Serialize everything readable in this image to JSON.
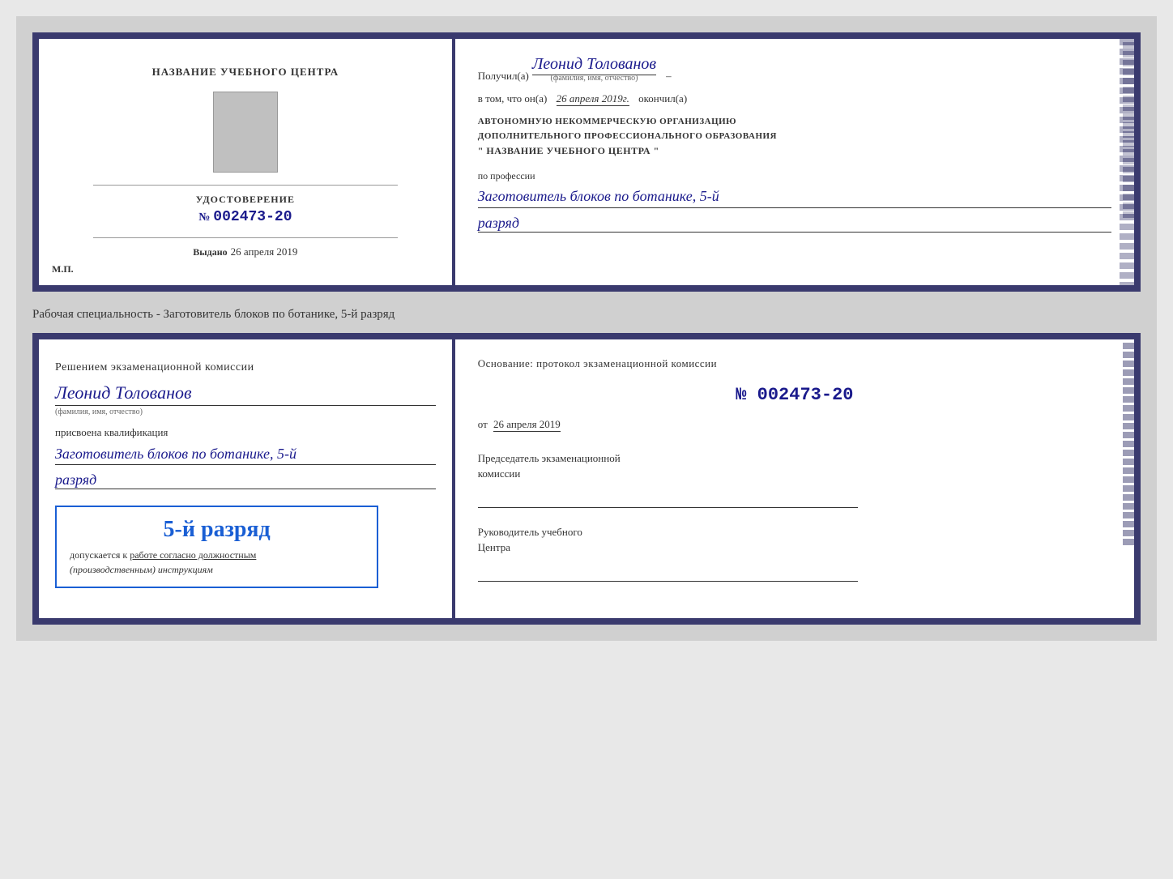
{
  "page": {
    "background": "#d0d0d0"
  },
  "cert1": {
    "left": {
      "title": "НАЗВАНИЕ УЧЕБНОГО ЦЕНТРА",
      "doc_label": "УДОСТОВЕРЕНИЕ",
      "doc_number_prefix": "№",
      "doc_number": "002473-20",
      "issued_label": "Выдано",
      "issued_date": "26 апреля 2019",
      "mp_label": "М.П."
    },
    "right": {
      "received_prefix": "Получил(а)",
      "recipient_name": "Леонид Толованов",
      "fio_label": "(фамилия, имя, отчество)",
      "date_prefix": "в том, что он(а)",
      "date_value": "26 апреля 2019г.",
      "date_suffix": "окончил(а)",
      "org_line1": "АВТОНОМНУЮ НЕКОММЕРЧЕСКУЮ ОРГАНИЗАЦИЮ",
      "org_line2": "ДОПОЛНИТЕЛЬНОГО ПРОФЕССИОНАЛЬНОГО ОБРАЗОВАНИЯ",
      "org_quotes": "\"",
      "org_name": "НАЗВАНИЕ УЧЕБНОГО ЦЕНТРА",
      "profession_label": "по профессии",
      "profession_value": "Заготовитель блоков по ботанике, 5-й",
      "rank_value": "разряд"
    }
  },
  "specialty_text": "Рабочая специальность - Заготовитель блоков по ботанике, 5-й разряд",
  "cert2": {
    "left": {
      "decision_text": "Решением экзаменационной комиссии",
      "person_name": "Леонид Толованов",
      "fio_label": "(фамилия, имя, отчество)",
      "assigned_label": "присвоена квалификация",
      "qualification": "Заготовитель блоков по ботанике, 5-й",
      "rank": "разряд",
      "stamp_rank": "5-й разряд",
      "stamp_prefix": "допускается к",
      "stamp_link_text": "работе согласно должностным",
      "stamp_suffix": "(производственным) инструкциям"
    },
    "right": {
      "basis_label": "Основание: протокол экзаменационной комиссии",
      "number_prefix": "№",
      "protocol_number": "002473-20",
      "date_prefix": "от",
      "protocol_date": "26 апреля 2019",
      "chairman_label": "Председатель экзаменационной",
      "chairman_label2": "комиссии",
      "director_label": "Руководитель учебного",
      "director_label2": "Центра"
    }
  }
}
